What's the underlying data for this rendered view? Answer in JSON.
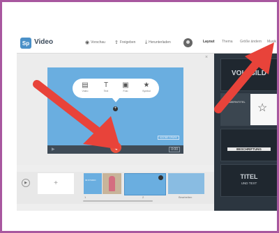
{
  "app": {
    "logo_badge": "Sp",
    "title": "Video",
    "toolbar": [
      {
        "label": "Vorschau",
        "icon": "eye-icon",
        "glyph": "◉"
      },
      {
        "label": "Freigeben",
        "icon": "share-icon",
        "glyph": "⇪"
      },
      {
        "label": "Herunterladen",
        "icon": "download-icon",
        "glyph": "⤓"
      }
    ],
    "tabs": [
      {
        "label": "Layout",
        "active": true
      },
      {
        "label": "Thema",
        "active": false
      },
      {
        "label": "Größe ändern",
        "active": false
      },
      {
        "label": "Musik",
        "active": false
      }
    ]
  },
  "editor": {
    "options": [
      {
        "label": "Video",
        "icon": "film-icon",
        "glyph": "▤"
      },
      {
        "label": "Text",
        "icon": "text-icon",
        "glyph": "T"
      },
      {
        "label": "Foto",
        "icon": "image-icon",
        "glyph": "▣"
      },
      {
        "label": "Symbol",
        "icon": "star-icon",
        "glyph": "★"
      }
    ],
    "add_glyph": "+",
    "small_badge": "ADOBE SPARK",
    "timecode": "0:00",
    "close_glyph": "×"
  },
  "timeline": {
    "add_label": "+",
    "play_glyph": "▶",
    "thumb1_text": "IM STUDIO",
    "slide_numbers": [
      "1",
      "2",
      "3"
    ],
    "last_label": "Bearbeiten"
  },
  "layouts": [
    {
      "label": "VOLLBILD"
    },
    {
      "label": "NUMMERNTITEL"
    },
    {
      "label": "BESCHRIFTUNG"
    },
    {
      "label": "TITEL",
      "sub": "UND TEXT"
    }
  ],
  "colors": {
    "frame_border": "#a8579f",
    "accent_blue": "#4a90c8",
    "mic_red": "#e9503e",
    "arrow_red": "#e8433a",
    "panel_dark": "#2c3640"
  }
}
